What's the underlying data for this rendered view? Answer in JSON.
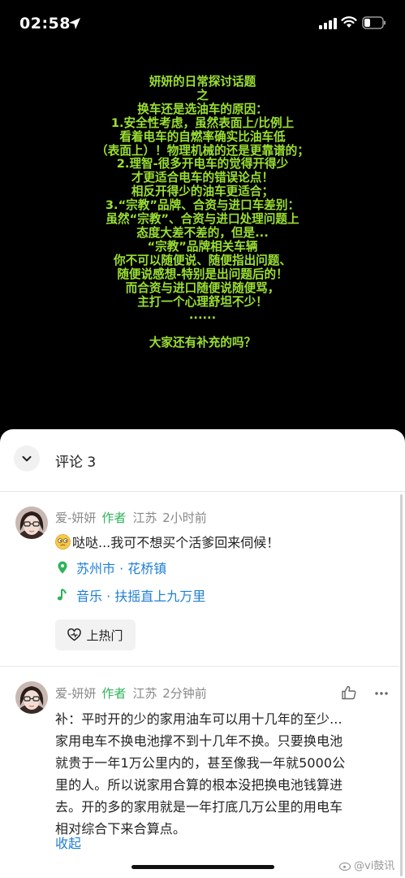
{
  "status_bar": {
    "time": "02:58"
  },
  "post": {
    "text_lines": [
      "妍妍的日常探讨话题",
      "之",
      "换车还是选油车的原因：",
      "1.安全性考虑，虽然表面上/比例上",
      "看着电车的自燃率确实比油车低",
      "（表面上）！物理机械的还是更靠谱的；",
      "2.理智-很多开电车的觉得开得少",
      "才更适合电车的错误论点！",
      "相反开得少的油车更适合；",
      "3.“宗教”品牌、合资与进口车差别：",
      "虽然“宗教”、合资与进口处理问题上",
      "态度大差不差的，但是...",
      "“宗教”品牌相关车辆",
      "你不可以随便说、随便指出问题、",
      "随便说感想-特别是出问题后的！",
      "而合资与进口随便说随便骂，",
      "主打一个心理舒坦不少！",
      "......",
      "",
      "大家还有补充的吗？"
    ],
    "text_color": "#9BE033"
  },
  "comments_panel": {
    "title": "评论 3",
    "comments": [
      {
        "author": "爱-妍妍",
        "author_tag": "作者",
        "region": "江苏",
        "time": "2小时前",
        "text": "哒哒...我可不想买个活爹回来伺候！",
        "location_tag": "苏州市 · 花桥镇",
        "music_tag": "音乐 · 扶摇直上九万里",
        "hot_button": "上热门"
      },
      {
        "author": "爱-妍妍",
        "author_tag": "作者",
        "region": "江苏",
        "time": "2分钟前",
        "text_lines": [
          "补：平时开的少的家用油车可以用十几年的至少...",
          "家用电车不换电池撑不到十几年不换。只要换电池",
          "就贵于一年1万公里内的，甚至像我一年就5000公",
          "里的人。所以说家用合算的根本没把换电池钱算进",
          "去。开的多的家用就是一年打底几万公里的用电车",
          "相对综合下来合算点。"
        ],
        "collapse_link": "收起"
      }
    ]
  },
  "watermark": "@vi鼓讯",
  "colors": {
    "accent_green": "#2eb35a",
    "link_blue": "#1f7fd6"
  }
}
